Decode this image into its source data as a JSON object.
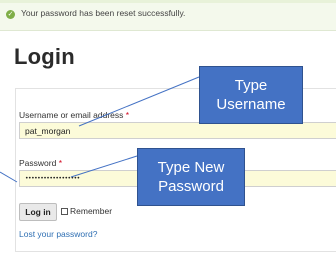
{
  "notice": {
    "icon": "check-circle-icon",
    "text": "Your password has been reset successfully.",
    "accent_color": "#7fae47"
  },
  "page": {
    "title": "Login"
  },
  "form": {
    "username_label": "Username or email address",
    "password_label": "Password",
    "required_marker": "*",
    "username_value": "pat_morgan",
    "password_value": "••••••••••••••••••",
    "login_button_label": "Log in",
    "remember_label": "Remember",
    "lost_password_link": "Lost your password?"
  },
  "callouts": {
    "username": {
      "line1": "Type",
      "line2": "Username"
    },
    "password": {
      "line1": "Type New",
      "line2": "Password"
    },
    "color": "#4472c4"
  }
}
